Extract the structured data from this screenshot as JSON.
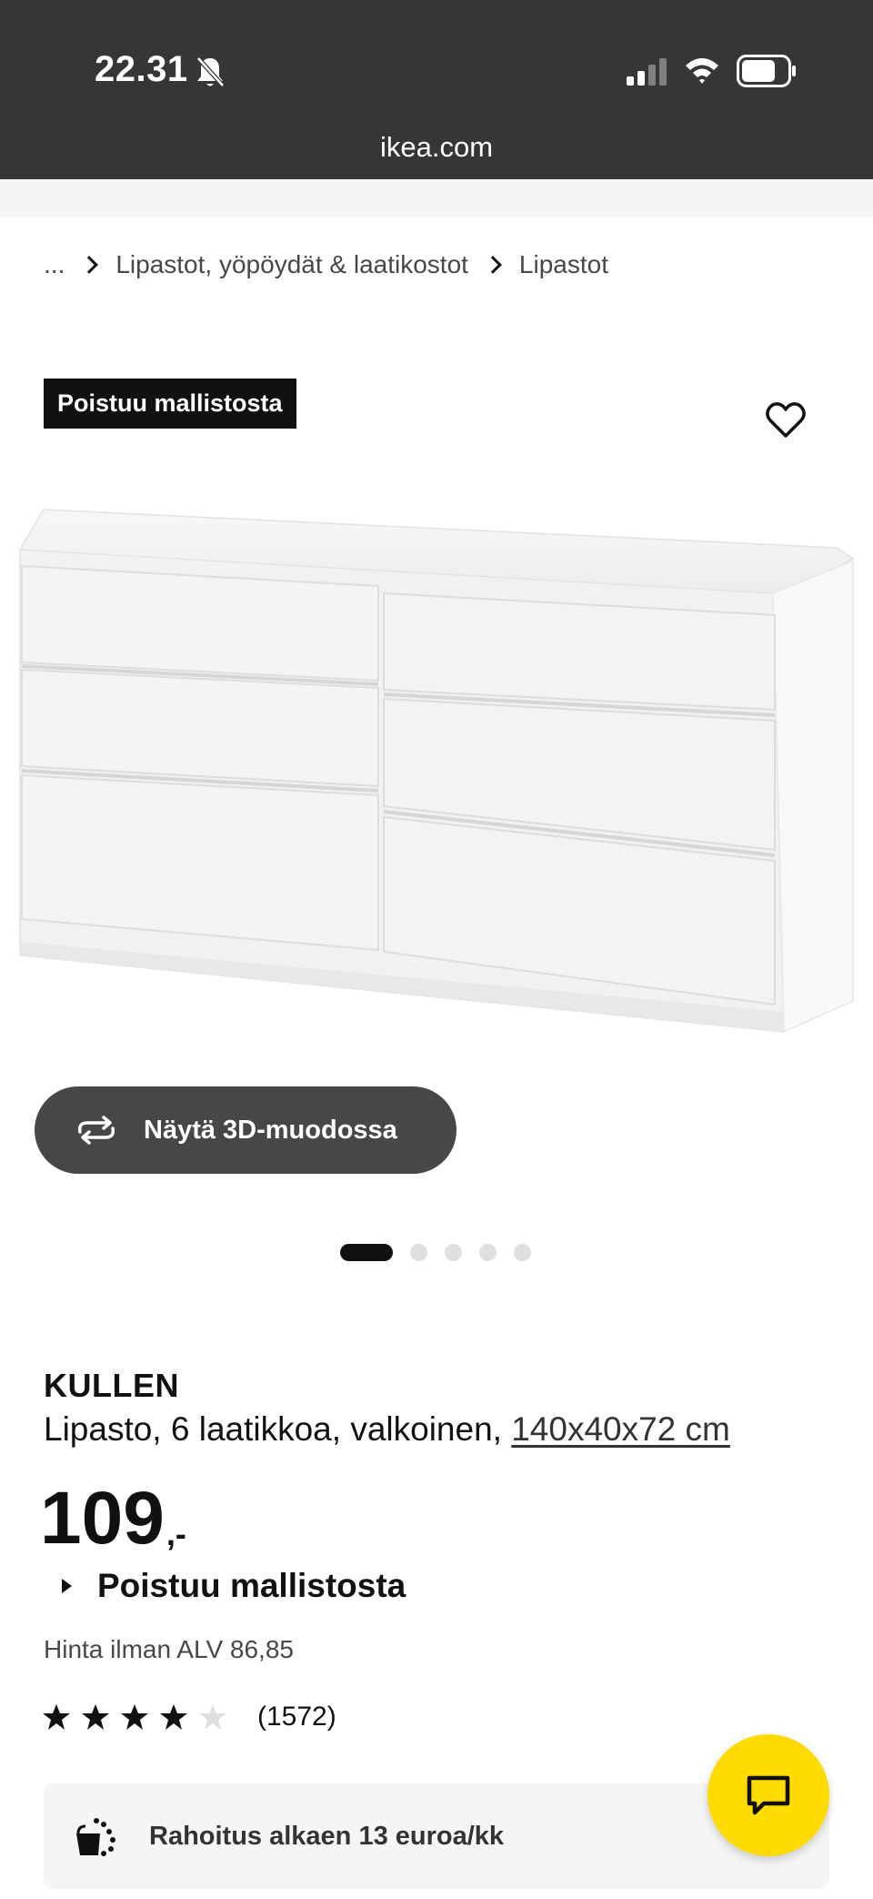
{
  "status_bar": {
    "time": "22.31",
    "icons": [
      "bell-slash-icon",
      "signal-icon",
      "wifi-icon",
      "battery-icon"
    ]
  },
  "browser": {
    "url": "ikea.com"
  },
  "breadcrumb": {
    "ellipsis": "...",
    "items": [
      "Lipastot, yöpöydät & laatikostot",
      "Lipastot"
    ]
  },
  "gallery": {
    "badge": "Poistuu mallistosta",
    "favorite_icon": "heart-outline-icon",
    "view_3d_label": "Näytä 3D-muodossa",
    "dots_total": 5,
    "dots_active_index": 0
  },
  "product": {
    "name": "KULLEN",
    "description": "Lipasto, 6 laatikkoa, valkoinen, ",
    "measurements": "140x40x72 cm",
    "price": "109",
    "price_suffix": ",-",
    "availability_toggle": "Poistuu mallistosta",
    "vat_text": "Hinta ilman ALV 86,85",
    "rating": 4,
    "rating_max": 5,
    "review_count": "(1572)"
  },
  "finance": {
    "label": "Rahoitus alkaen 13 euroa/kk",
    "icon": "wallet-coins-icon"
  },
  "chat": {
    "icon": "chat-bubble-icon",
    "color": "#ffdb00"
  },
  "colors": {
    "topbar": "#343638",
    "accent": "#ffdb00",
    "badge_bg": "#111111",
    "button_3d_bg": "#474747"
  }
}
